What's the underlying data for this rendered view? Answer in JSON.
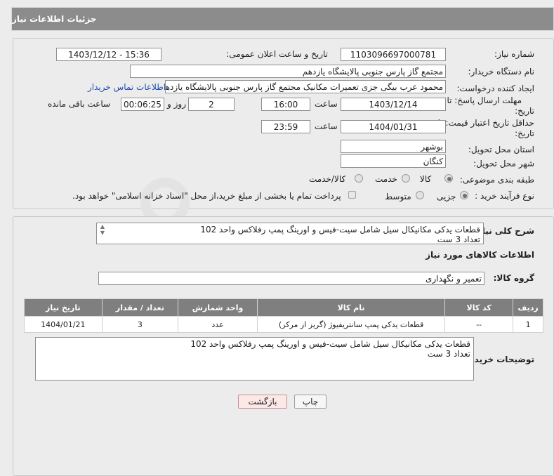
{
  "header": {
    "title": "جزئیات اطلاعات نیاز"
  },
  "fields": {
    "need_number_label": "شماره نیاز:",
    "need_number": "1103096697000781",
    "announce_label": "تاریخ و ساعت اعلان عمومی:",
    "announce_value": "1403/12/12 - 15:36",
    "buyer_org_label": "نام دستگاه خریدار:",
    "buyer_org": "مجتمع گاز پارس جنوبی  پالایشگاه یازدهم",
    "creator_label": "ایجاد کننده درخواست:",
    "creator": "محمود عرب بیگی جزی تعمیرات مکانیک مجتمع گاز پارس جنوبی  پالایشگاه یازدهم",
    "contact_link": "اطلاعات تماس خریدار",
    "deadline_label_1": "مهلت ارسال پاسخ: تا",
    "deadline_label_2": "تاریخ:",
    "deadline_date": "1403/12/14",
    "time_label": "ساعت",
    "deadline_time": "16:00",
    "days_value": "2",
    "days_label": "روز و",
    "remaining_value": "00:06:25",
    "remaining_label": "ساعت باقی مانده",
    "validity_label_1": "حداقل تاریخ اعتبار قیمت: تا",
    "validity_label_2": "تاریخ:",
    "validity_date": "1404/01/31",
    "validity_time_label": "ساعت",
    "validity_time": "23:59",
    "province_label": "استان محل تحویل:",
    "province": "بوشهر",
    "city_label": "شهر محل تحویل:",
    "city": "کنگان",
    "category_label": "طبقه بندی موضوعی:",
    "category_options": [
      "کالا",
      "خدمت",
      "کالا/خدمت"
    ],
    "process_label": "نوع فرآیند خرید :",
    "process_options": [
      "جزیی",
      "متوسط"
    ],
    "payment_note": "پرداخت تمام یا بخشی از مبلغ خرید،از محل \"اسناد خزانه اسلامی\" خواهد بود."
  },
  "description": {
    "label": "شرح کلی نیاز:",
    "text": "قطعات یدکی مکانیکال سیل شامل سیت-فیس و اورینگ پمپ رفلاکس واحد 102\nتعداد 3 ست"
  },
  "goods": {
    "section_title": "اطلاعات کالاهای مورد نیاز",
    "group_label": "گروه کالا:",
    "group_value": "تعمیر و نگهداری",
    "columns": [
      "ردیف",
      "کد کالا",
      "نام کالا",
      "واحد شمارش",
      "تعداد / مقدار",
      "تاریخ نیاز"
    ],
    "rows": [
      [
        "1",
        "--",
        "قطعات یدکی پمپ سانتریفیوژ (گریز از مرکز)",
        "عدد",
        "3",
        "1404/01/21"
      ]
    ]
  },
  "buyer_notes": {
    "label": "توضیحات خریدار:",
    "text": "قطعات یدکی مکانیکال سیل شامل سیت-فیس و اورینگ پمپ رفلاکس واحد 102\nتعداد 3 ست"
  },
  "buttons": {
    "print": "چاپ",
    "back": "بازگشت"
  },
  "watermark": "AriaTender.neT"
}
